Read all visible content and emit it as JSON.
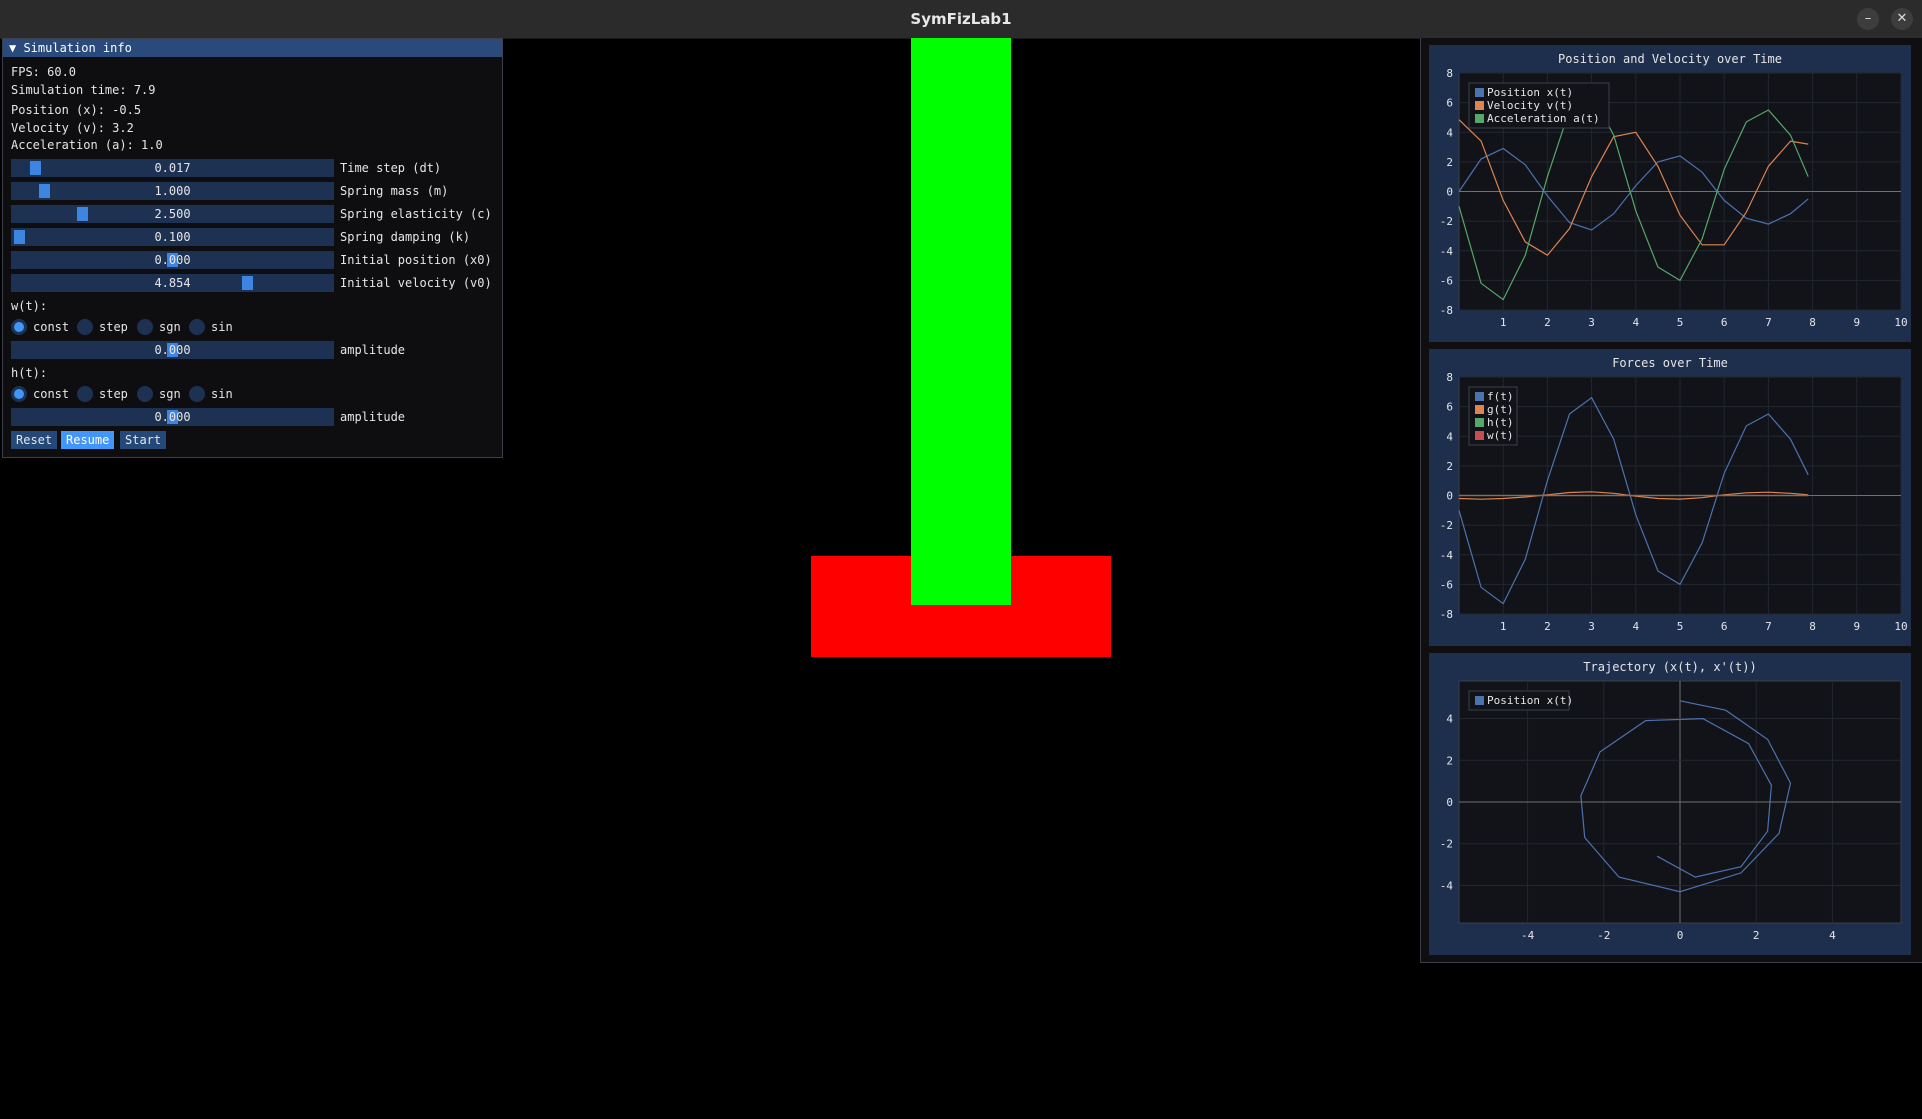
{
  "window": {
    "title": "SymFizLab1",
    "minimize_icon": "–",
    "close_icon": "✕"
  },
  "panel": {
    "header": "▼ Simulation info",
    "fps": "FPS: 60.0",
    "sim_time": "Simulation time: 7.9",
    "position": "Position (x): -0.5",
    "velocity": "Velocity (v): 3.2",
    "acceleration": "Acceleration (a): 1.0",
    "sliders": [
      {
        "value": "0.017",
        "label": "Time step (dt)",
        "fraction": 0.06
      },
      {
        "value": "1.000",
        "label": "Spring mass (m)",
        "fraction": 0.09
      },
      {
        "value": "2.500",
        "label": "Spring elasticity (c)",
        "fraction": 0.21
      },
      {
        "value": "0.100",
        "label": "Spring damping (k)",
        "fraction": 0.01
      },
      {
        "value": "0.000",
        "label": "Initial position (x0)",
        "fraction": 0.5
      },
      {
        "value": "4.854",
        "label": "Initial velocity (v0)",
        "fraction": 0.74
      }
    ],
    "w_label": "w(t):",
    "h_label": "h(t):",
    "radio_options": [
      "const",
      "step",
      "sgn",
      "sin"
    ],
    "selected_option": "const",
    "amplitude_label": "amplitude",
    "amplitude_value": "0.000",
    "buttons": {
      "reset": "Reset",
      "resume": "Resume",
      "start": "Start"
    }
  },
  "scene": {
    "rod_color": "#00ff00",
    "base_color": "#ff0000"
  },
  "chart_data": [
    {
      "type": "line",
      "title": "Position and Velocity over Time",
      "xlim": [
        0,
        10
      ],
      "ylim": [
        -8,
        8
      ],
      "x_ticks": [
        1,
        2,
        3,
        4,
        5,
        6,
        7,
        8,
        9,
        10
      ],
      "y_ticks": [
        8,
        6,
        4,
        2,
        0,
        -2,
        -4,
        -6,
        -8
      ],
      "legend": "top-left",
      "grid": true,
      "series": [
        {
          "name": "Position x(t)",
          "color": "#4c72b0",
          "x": [
            0,
            0.5,
            1,
            1.5,
            2,
            2.5,
            3,
            3.5,
            4,
            4.5,
            5,
            5.5,
            6,
            6.5,
            7,
            7.5,
            7.9
          ],
          "y": [
            0,
            2.2,
            2.9,
            1.8,
            -0.3,
            -2.1,
            -2.6,
            -1.5,
            0.4,
            2.0,
            2.4,
            1.3,
            -0.6,
            -1.8,
            -2.2,
            -1.5,
            -0.5
          ]
        },
        {
          "name": "Velocity v(t)",
          "color": "#dd8452",
          "x": [
            0,
            0.5,
            1,
            1.5,
            2,
            2.5,
            3,
            3.5,
            4,
            4.5,
            5,
            5.5,
            6,
            6.5,
            7,
            7.5,
            7.9
          ],
          "y": [
            4.85,
            3.4,
            -0.6,
            -3.4,
            -4.3,
            -2.5,
            1.0,
            3.7,
            4.0,
            1.7,
            -1.6,
            -3.6,
            -3.6,
            -1.4,
            1.7,
            3.4,
            3.2
          ]
        },
        {
          "name": "Acceleration a(t)",
          "color": "#55a868",
          "x": [
            0,
            0.5,
            1,
            1.5,
            2,
            2.5,
            3,
            3.5,
            4,
            4.5,
            5,
            5.5,
            6,
            6.5,
            7,
            7.5,
            7.9
          ],
          "y": [
            -1,
            -6.2,
            -7.3,
            -4.3,
            1.0,
            5.5,
            6.6,
            3.8,
            -1.3,
            -5.1,
            -6.0,
            -3.2,
            1.5,
            4.7,
            5.5,
            3.8,
            1.0
          ]
        }
      ]
    },
    {
      "type": "line",
      "title": "Forces over Time",
      "xlim": [
        0,
        10
      ],
      "ylim": [
        -8,
        8
      ],
      "x_ticks": [
        1,
        2,
        3,
        4,
        5,
        6,
        7,
        8,
        9,
        10
      ],
      "y_ticks": [
        8,
        6,
        4,
        2,
        0,
        -2,
        -4,
        -6,
        -8
      ],
      "legend": "top-left",
      "grid": true,
      "series": [
        {
          "name": "f(t)",
          "color": "#4c72b0",
          "x": [
            0,
            0.5,
            1,
            1.5,
            2,
            2.5,
            3,
            3.5,
            4,
            4.5,
            5,
            5.5,
            6,
            6.5,
            7,
            7.5,
            7.9
          ],
          "y": [
            -1,
            -6.2,
            -7.3,
            -4.3,
            1.0,
            5.5,
            6.6,
            3.8,
            -1.3,
            -5.1,
            -6.0,
            -3.2,
            1.5,
            4.7,
            5.5,
            3.8,
            1.4
          ]
        },
        {
          "name": "g(t)",
          "color": "#dd8452",
          "x": [
            0,
            0.5,
            1,
            1.5,
            2,
            2.5,
            3,
            3.5,
            4,
            4.5,
            5,
            5.5,
            6,
            6.5,
            7,
            7.5,
            7.9
          ],
          "y": [
            -0.2,
            -0.25,
            -0.2,
            -0.1,
            0.05,
            0.2,
            0.25,
            0.15,
            -0.05,
            -0.2,
            -0.24,
            -0.15,
            0.05,
            0.18,
            0.22,
            0.15,
            0.05
          ]
        },
        {
          "name": "h(t)",
          "color": "#55a868",
          "x": [
            0,
            7.9
          ],
          "y": [
            0,
            0
          ]
        },
        {
          "name": "w(t)",
          "color": "#c44e52",
          "x": [
            0,
            7.9
          ],
          "y": [
            0,
            0
          ]
        }
      ]
    },
    {
      "type": "line",
      "title": "Trajectory (x(t), x'(t))",
      "xlim": [
        -5.8,
        5.8
      ],
      "ylim": [
        -5.8,
        5.8
      ],
      "x_ticks": [
        -4,
        -2,
        0,
        2,
        4
      ],
      "y_ticks": [
        4,
        2,
        0,
        -2,
        -4
      ],
      "legend": "top-left",
      "grid": true,
      "series": [
        {
          "name": "Position x(t)",
          "color": "#4c72b0",
          "x": [
            0,
            1.2,
            2.3,
            2.9,
            2.6,
            1.6,
            0,
            -1.6,
            -2.5,
            -2.6,
            -2.1,
            -0.9,
            0.6,
            1.8,
            2.4,
            2.3,
            1.6,
            0.4,
            -0.6
          ],
          "y": [
            4.85,
            4.4,
            3.0,
            0.9,
            -1.5,
            -3.4,
            -4.3,
            -3.6,
            -1.7,
            0.3,
            2.4,
            3.9,
            4.0,
            2.8,
            0.8,
            -1.4,
            -3.1,
            -3.6,
            -2.6
          ]
        }
      ]
    }
  ]
}
